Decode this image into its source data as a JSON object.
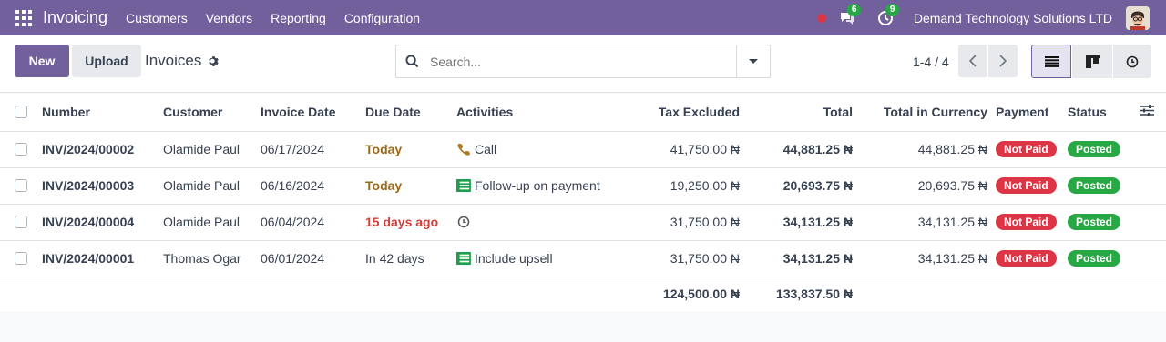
{
  "navbar": {
    "app_name": "Invoicing",
    "menu": [
      "Customers",
      "Vendors",
      "Reporting",
      "Configuration"
    ],
    "chat_count": "6",
    "activity_count": "9",
    "company": "Demand Technology Solutions LTD"
  },
  "control": {
    "new_label": "New",
    "upload_label": "Upload",
    "breadcrumb": "Invoices",
    "search_placeholder": "Search...",
    "pager": "1-4 / 4"
  },
  "table": {
    "columns": {
      "number": "Number",
      "customer": "Customer",
      "invoice_date": "Invoice Date",
      "due_date": "Due Date",
      "activities": "Activities",
      "tax_excluded": "Tax Excluded",
      "total": "Total",
      "total_currency": "Total in Currency",
      "payment": "Payment",
      "status": "Status"
    },
    "rows": [
      {
        "number": "INV/2024/00002",
        "customer": "Olamide Paul",
        "invoice_date": "06/17/2024",
        "due_date": "Today",
        "due_state": "today",
        "activity_icon": "phone-icon",
        "activity": "Call",
        "tax_excluded": "41,750.00 ₦",
        "total": "44,881.25 ₦",
        "total_currency": "44,881.25 ₦",
        "payment": "Not Paid",
        "status": "Posted"
      },
      {
        "number": "INV/2024/00003",
        "customer": "Olamide Paul",
        "invoice_date": "06/16/2024",
        "due_date": "Today",
        "due_state": "today",
        "activity_icon": "money-icon",
        "activity": "Follow-up on payment",
        "tax_excluded": "19,250.00 ₦",
        "total": "20,693.75 ₦",
        "total_currency": "20,693.75 ₦",
        "payment": "Not Paid",
        "status": "Posted"
      },
      {
        "number": "INV/2024/00004",
        "customer": "Olamide Paul",
        "invoice_date": "06/04/2024",
        "due_date": "15 days ago",
        "due_state": "late",
        "activity_icon": "clock-icon",
        "activity": "",
        "tax_excluded": "31,750.00 ₦",
        "total": "34,131.25 ₦",
        "total_currency": "34,131.25 ₦",
        "payment": "Not Paid",
        "status": "Posted"
      },
      {
        "number": "INV/2024/00001",
        "customer": "Thomas Ogar",
        "invoice_date": "06/01/2024",
        "due_date": "In 42 days",
        "due_state": "future",
        "activity_icon": "money-icon",
        "activity": "Include upsell",
        "tax_excluded": "31,750.00 ₦",
        "total": "34,131.25 ₦",
        "total_currency": "34,131.25 ₦",
        "payment": "Not Paid",
        "status": "Posted"
      }
    ],
    "totals": {
      "tax_excluded": "124,500.00 ₦",
      "total": "133,837.50 ₦"
    }
  },
  "colors": {
    "brand": "#72609c",
    "not_paid": "#dc3545",
    "posted": "#28a745",
    "due_today": "#9a6a1a",
    "due_late": "#d23f3a"
  }
}
